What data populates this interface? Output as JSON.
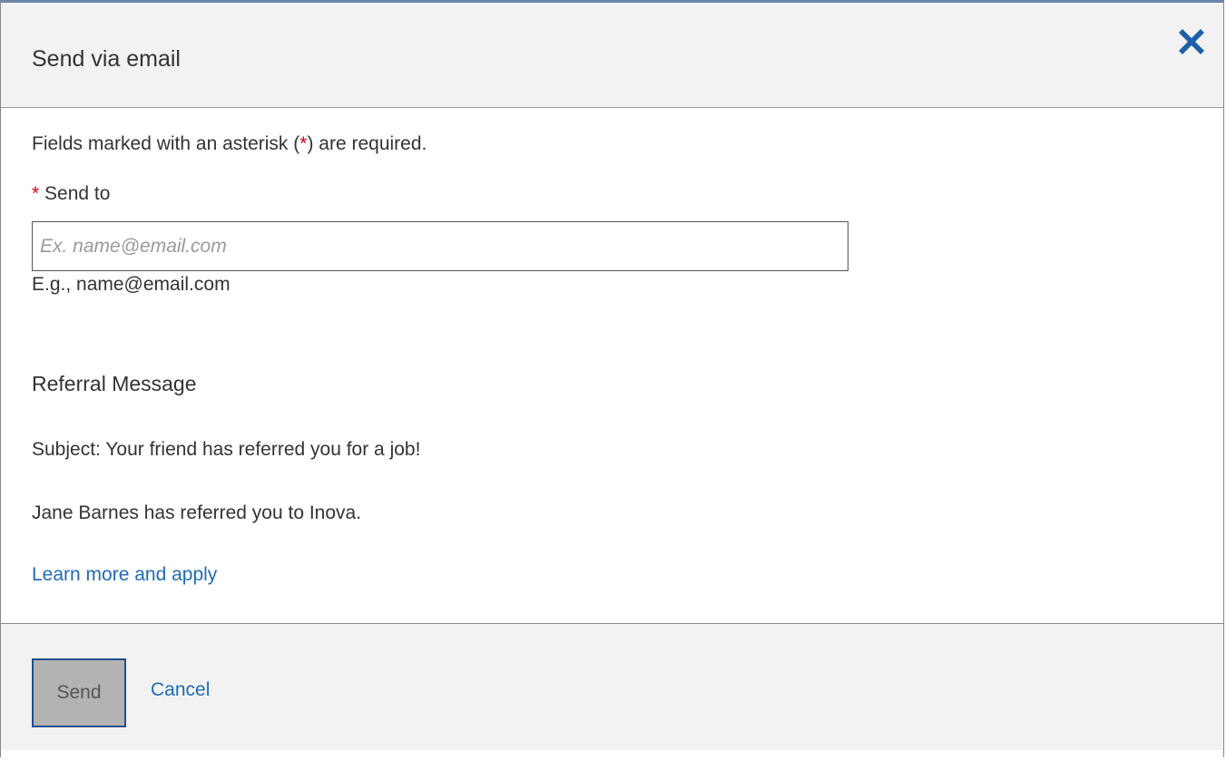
{
  "dialog": {
    "title": "Send via email",
    "close_icon": "close-icon"
  },
  "form": {
    "required_note_prefix": "Fields marked with an asterisk (",
    "required_note_star": "*",
    "required_note_suffix": ") are required.",
    "send_to_star": "*",
    "send_to_label": "Send to",
    "send_to_placeholder": "Ex. name@email.com",
    "send_to_value": "",
    "send_to_hint": "E.g., name@email.com"
  },
  "referral": {
    "heading": "Referral Message",
    "subject": "Subject: Your friend has referred you for a job!",
    "message": "Jane Barnes has referred you to Inova.",
    "link_text": "Learn more and apply"
  },
  "footer": {
    "send_label": "Send",
    "cancel_label": "Cancel"
  },
  "colors": {
    "link": "#1f6bb5",
    "required_star": "#d0021b",
    "close_icon": "#1f5fa8",
    "header_bg": "#f2f2f2",
    "send_button_bg": "#b3b3b3",
    "send_button_border": "#1f4e8c"
  }
}
